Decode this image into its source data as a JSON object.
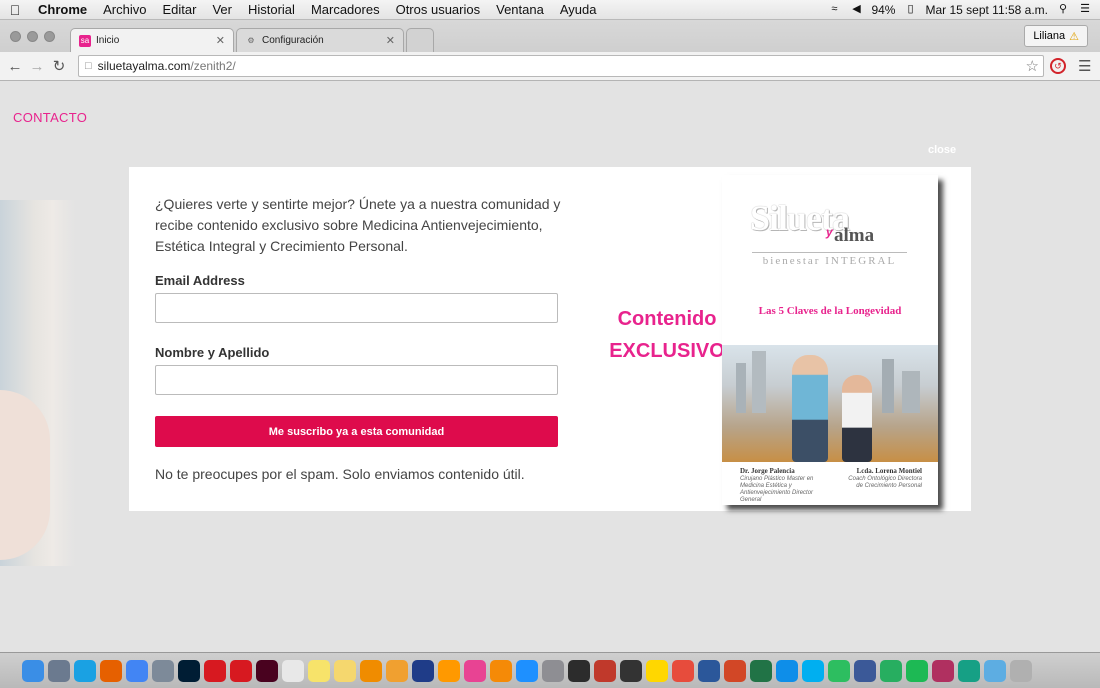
{
  "menubar": {
    "apple": "",
    "items": [
      "Chrome",
      "Archivo",
      "Editar",
      "Ver",
      "Historial",
      "Marcadores",
      "Otros usuarios",
      "Ventana",
      "Ayuda"
    ],
    "battery": "94%",
    "datetime": "Mar 15 sept  11:58 a.m.",
    "icons": [
      "wifi-icon",
      "volume-icon",
      "battery-icon",
      "spotlight-icon",
      "notifications-icon"
    ]
  },
  "browser": {
    "tabs": [
      {
        "label": "Inicio",
        "favicon": "siluetayalma-icon",
        "active": true
      },
      {
        "label": "Configuración",
        "favicon": "gear-icon",
        "active": false
      }
    ],
    "user": "Liliana",
    "url_host": "siluetayalma.com",
    "url_path": "/zenith2/"
  },
  "page": {
    "nav_contacto": "CONTACTO",
    "close": "close",
    "intro": "¿Quieres verte y sentirte mejor? Únete ya a nuestra comunidad y recibe contenido exclusivo sobre Medicina Antienvejecimiento, Estética Integral y Crecimiento Personal.",
    "email_label": "Email Address",
    "email_value": "",
    "name_label": "Nombre y Apellido",
    "name_value": "",
    "cta": "Me suscribo ya a esta comunidad",
    "spam_note": "No te preocupes por el spam. Solo enviamos contenido útil.",
    "promo_line1": "Contenido",
    "promo_line2": "EXCLUSIVO",
    "book": {
      "logo": "Silueta",
      "logo_y": "y",
      "logo2": "alma",
      "subtitle": "bienestar INTEGRAL",
      "title": "Las 5 Claves de la Longevidad",
      "author1_name": "Dr. Jorge Palencia",
      "author1_role": "Cirujano Plástico Master en Medicina Estética y Antienvejecimiento Director General",
      "author2_name": "Lcda. Lorena Montiel",
      "author2_role": "Coach Ontológico Directora de Crecimiento Personal"
    }
  },
  "dock": {
    "apps": [
      "finder-icon",
      "launchpad-icon",
      "skype-icon",
      "firefox-icon",
      "chrome-icon",
      "preview-icon",
      "photoshop-icon",
      "acrobat-icon",
      "acrobat-reader-icon",
      "indesign-icon",
      "calendar-icon",
      "notes-icon",
      "stickies-icon",
      "vlc-icon",
      "photos-icon",
      "quicktime-icon",
      "amazon-icon",
      "itunes-icon",
      "ibooks-icon",
      "app-store-icon",
      "system-preferences-icon",
      "final-cut-icon",
      "transmission-icon",
      "activity-monitor-icon",
      "cleaner-icon",
      "popcorn-icon",
      "word-icon",
      "powerpoint-icon",
      "excel-icon",
      "teamviewer-icon",
      "skype-blue-icon",
      "evernote-icon",
      "network-icon",
      "facetime-icon",
      "spotify-icon",
      "photo-booth-icon",
      "capture-icon",
      "downloads-icon",
      "trash-icon"
    ]
  }
}
